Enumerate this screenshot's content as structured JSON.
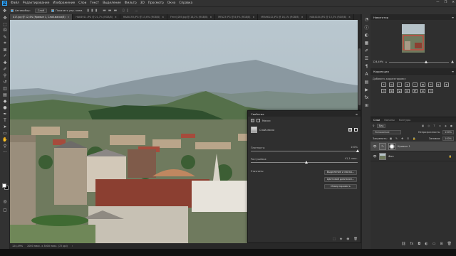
{
  "app": {
    "logo": "Ps"
  },
  "menu": [
    "Файл",
    "Редактирование",
    "Изображение",
    "Слои",
    "Текст",
    "Выделение",
    "Фильтр",
    "3D",
    "Просмотр",
    "Окно",
    "Справка"
  ],
  "window_controls": [
    "—",
    "❐",
    "✕"
  ],
  "options": {
    "tool_icon": "move-tool-icon",
    "autoselect_label": "Автовыбор:",
    "autoselect_value": "Слой",
    "show_controls_label": "Показать упр. элем.",
    "more": "···"
  },
  "tabs": [
    {
      "label": "017.jpg @ 12,4% (Кривые 1, Слой-маска/8)",
      "active": true
    },
    {
      "label": "HA84911.IPG @ 21,7% (RGB/8)",
      "active": false
    },
    {
      "label": "HA84193.JPG @ 15,6% (RGB/8)",
      "active": false
    },
    {
      "label": "Fmrd_089.jpg @ 16,2% (RGB/8)",
      "active": false
    },
    {
      "label": "MFA23 IPG @ 8,9% (RGB/8)",
      "active": false
    },
    {
      "label": "MFA96142.JPG @ 16,1% (RGB/8)",
      "active": false
    },
    {
      "label": "HA84184.JPG @ 13,3% (RGB/8)",
      "active": false
    }
  ],
  "status": {
    "zoom": "124,49%",
    "doc": "2000 пикс. x 3000 пикс. (72 ppi)"
  },
  "navigator": {
    "title": "Навигатор",
    "zoom": "124,49%"
  },
  "adjustments": {
    "title": "Коррекция",
    "label": "Добавить корректировку"
  },
  "layers_panel": {
    "tabs": [
      "Слои",
      "Каналы",
      "Контуры"
    ],
    "kind_label": "Вид",
    "blend_mode": "Умножение",
    "opacity_label": "Непрозрачность:",
    "opacity_value": "100%",
    "lock_label": "Закрепить:",
    "fill_label": "Заливка:",
    "fill_value": "100%",
    "layers": [
      {
        "name": "Кривые 1",
        "active": true
      },
      {
        "name": "Фон",
        "active": false
      }
    ]
  },
  "properties": {
    "title": "Свойства",
    "section": "Маски",
    "mask_label": "Слой-маска",
    "density_label": "Плотность:",
    "density_value": "100%",
    "density_fraction": 1.0,
    "feather_label": "Растушёвка:",
    "feather_value": "41,1 пикс.",
    "feather_fraction": 0.52,
    "refine_label": "Уточнить:",
    "buttons": [
      "Выделение и маска...",
      "Цветовой диапазон...",
      "Инвертировать"
    ]
  }
}
